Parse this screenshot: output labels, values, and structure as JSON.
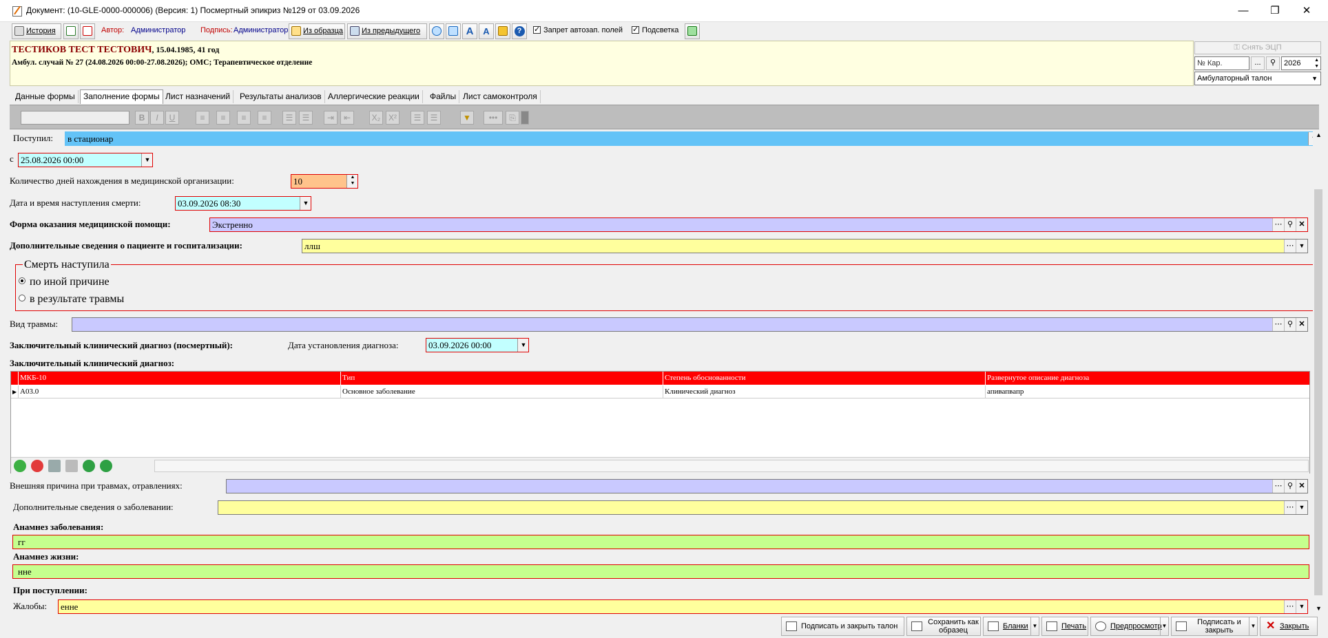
{
  "window": {
    "title": "Документ: (10-GLE-0000-000006) (Версия: 1) Посмертный эпикриз №129 от 03.09.2026",
    "minimize": "—",
    "maximize": "❐",
    "close": "✕"
  },
  "toolbar": {
    "history": "История",
    "author_label": "Автор:",
    "author_value": "Администратор",
    "sign_label": "Подпись:",
    "sign_value": "Администратор",
    "from_template": "Из образца",
    "from_previous": "Из предыдущего",
    "no_autofill": "Запрет автозап. полей",
    "highlight": "Подсветка",
    "help": "?"
  },
  "header": {
    "patient_name": "ТЕСТИКОВ ТЕСТ ТЕСТОВИЧ",
    "patient_dob": ", 15.04.1985, 41 год",
    "case_info": "Амбул. случай  № 27 (24.08.2026 00:00-27.08.2026); ОМС; Терапевтическое отделение"
  },
  "right_panel": {
    "remove_sign": "Снять ЭЦП",
    "card_no_placeholder": "№ Кар.",
    "ellipsis": "...",
    "year": "2026",
    "doc_type": "Амбулаторный талон"
  },
  "tabs": [
    "Данные формы",
    "Заполнение формы",
    "Лист назначений",
    "Результаты анализов",
    "Аллергические реакции",
    "Файлы",
    "Лист самоконтроля"
  ],
  "form": {
    "admitted_label": "Поступил:",
    "admitted_value": "в стационар",
    "from_label": "с",
    "from_value": "25.08.2026 00:00",
    "days_label": "Количество дней нахождения в медицинской организации:",
    "days_value": "10",
    "death_label": "Дата и время наступления смерти:",
    "death_value": "03.09.2026 08:30",
    "care_form_label": "Форма оказания медицинской помощи:",
    "care_form_value": "Экстренно",
    "extra_info_label": "Дополнительные сведения о пациенте и госпитализации:",
    "extra_info_value": "ллш",
    "death_group_title": "Смерть наступила",
    "death_opt1": "по иной причине",
    "death_opt2": "в результате травмы",
    "trauma_label": "Вид травмы:",
    "trauma_value": "",
    "final_dx_label": "Заключительный клинический диагноз (посмертный):",
    "dx_date_label": "Дата установления диагноза:",
    "dx_date_value": "03.09.2026 00:00",
    "final_dx_grid_label": "Заключительный клинический диагноз:",
    "external_cause_label": "Внешняя причина при травмах, отравлениях:",
    "external_cause_value": "",
    "disease_info_label": "Дополнительные сведения о заболевании:",
    "disease_info_value": "",
    "anamnesis_disease_label": "Анамнез заболевания:",
    "anamnesis_disease_value": "гг",
    "anamnesis_life_label": "Анамнез жизни:",
    "anamnesis_life_value": "нне",
    "on_admission_label": "При поступлении:",
    "complaints_label": "Жалобы:",
    "complaints_value": "енне"
  },
  "grid": {
    "columns": [
      "МКБ-10",
      "Тип",
      "Степень обоснованности",
      "Развернутое описание диагноза"
    ],
    "rows": [
      [
        "A03.0",
        "Основное заболевание",
        "Клинический диагноз",
        "апивапвапр"
      ]
    ]
  },
  "bottom": {
    "sign_close_ticket": "Подписать и закрыть талон",
    "save_template_1": "Сохранить как",
    "save_template_2": "образец",
    "forms": "Бланки",
    "print": "Печать",
    "preview": "Предпросмотр",
    "sign_close_1": "Подписать и",
    "sign_close_2": "закрыть",
    "close": "Закрыть"
  },
  "colors": {
    "required_border": "#e00000",
    "grid_header": "#ff0000",
    "header_bg": "#ffffe1"
  }
}
